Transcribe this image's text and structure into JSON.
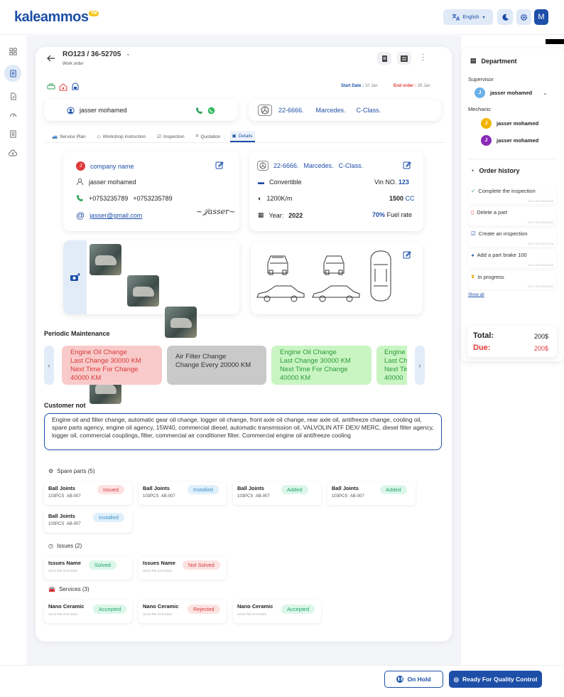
{
  "app": {
    "logo": "kaleammos",
    "logo_badge": "FM"
  },
  "header": {
    "language": "English",
    "avatar_letter": "M"
  },
  "order": {
    "title": "RO123 / 36-52705",
    "subtitle": "Work order",
    "start_label": "Start Date :",
    "start_value": "10 Jan",
    "end_label": "End order :",
    "end_value": "29 Jan"
  },
  "customer_bar": {
    "name": "jasser mohamed",
    "plate": "22-6666.",
    "make": "Marcedes.",
    "model": "C-Class."
  },
  "tabs": [
    "Service Plan",
    "Workshop instruction",
    "Inspection",
    "Quotation",
    "Details"
  ],
  "details": {
    "company": "company name",
    "name": "jasser mohamed",
    "phone1": "+0753235789",
    "phone2": "+0753235789",
    "email": "jasser@gmail.com",
    "plate": "22-6666.",
    "make": "Marcedes.",
    "model": "C-Class.",
    "body": "Convertible",
    "vin_label": "Vin NO.",
    "vin_value": "123",
    "km": "1200K/m",
    "cc_value": "1500",
    "cc_unit": "CC",
    "year_label": "Year:",
    "year_value": "2022",
    "fuel_pct": "70%",
    "fuel_label": "Fuel rate"
  },
  "periodic": {
    "title": "Periodic Maintenance",
    "cards": [
      {
        "l1": "Engine Oil Change",
        "l2": "Last Change 30000 KM",
        "l3": "Next Time For Change",
        "l4": "40000 KM"
      },
      {
        "l1": "Air Filter Change",
        "l2": "Change Every 20000 KM"
      },
      {
        "l1": "Engine Oil Change",
        "l2": "Last Change 30000 KM",
        "l3": "Next Time For Change",
        "l4": "40000 KM"
      },
      {
        "l1": "Engine",
        "l2": "Last Ch",
        "l3": "Next Tir",
        "l4": "40000"
      }
    ]
  },
  "note": {
    "title": "Customer not",
    "text": "Engine oil and filter change, automatic gear oil change, logger oil change, front axle oil change, rear axle oil, antifreeze change, cooling oil, spare parts agency, engine oil agency, 15W40, commercial diesel, automatic transmission oil, VALVOLIN ATF DEX/ MERC, diesel filter agency, logger oil, commercial couplings, filter, commercial air conditioner filter. Commercial engine oil antifreeze cooling"
  },
  "spare": {
    "title": "Spare parts (5)",
    "items": [
      {
        "name": "Ball Joints",
        "qty": "103PCS",
        "code": "AB-007",
        "status": "Issued"
      },
      {
        "name": "Ball Joints",
        "qty": "103PCS",
        "code": "AB-007",
        "status": "Installed"
      },
      {
        "name": "Ball Joints",
        "qty": "103PCS",
        "code": "AB-007",
        "status": "Added"
      },
      {
        "name": "Ball Joints",
        "qty": "103PCS",
        "code": "AB-007",
        "status": "Added"
      },
      {
        "name": "Ball Joints",
        "qty": "103PCS",
        "code": "AB-007",
        "status": "Installed"
      }
    ]
  },
  "issues": {
    "title": "Issues (2)",
    "items": [
      {
        "name": "Issues Name",
        "date": "10:21 PM 23-8-2024",
        "status": "Solved"
      },
      {
        "name": "Issues Name",
        "date": "10:21 PM 23-8-2024",
        "status": "Not Solved"
      }
    ]
  },
  "services": {
    "title": "Services (3)",
    "items": [
      {
        "name": "Nano Ceramic",
        "date": "10:21 PM 23-8-2024",
        "status": "Accepted"
      },
      {
        "name": "Nano Ceramic",
        "date": "10:21 PM 23-8-2024",
        "status": "Rejected"
      },
      {
        "name": "Nano Ceramic",
        "date": "10:21 PM 23-8-2024",
        "status": "Accepted"
      }
    ]
  },
  "side": {
    "department": "Department",
    "supervisor_label": "Supervisor",
    "supervisor": "jasser mohamed",
    "mechanic_label": "Mechanic",
    "mechanics": [
      "jasser mohamed",
      "jasser mohamed"
    ],
    "history_title": "Order history",
    "history": [
      {
        "text": "Complete the inspection",
        "date": "10:21 PM 23-8-2024"
      },
      {
        "text": "Delete a part",
        "date": "10:21 PM 23-8-2024"
      },
      {
        "text": "Create an inspection",
        "date": "10:21 PM 23-8-2024"
      },
      {
        "text": "Add a part brake 100",
        "date": "10:21 PM 23-8-2024"
      },
      {
        "text": "In progress",
        "date": "10:21 PM 23-8-2024"
      }
    ],
    "show_all": "Show all",
    "total_label": "Total:",
    "total_value": "200$",
    "due_label": "Due:",
    "due_value": "200$"
  },
  "footer": {
    "hold": "On Hold",
    "ready": "Ready For Quality Control"
  },
  "colors": {
    "accent": "#1d4fa8",
    "danger": "#e03b3b"
  }
}
